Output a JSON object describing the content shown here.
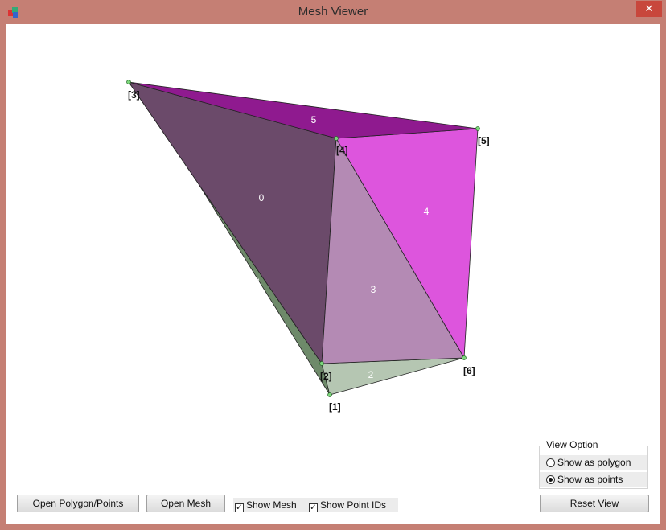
{
  "window": {
    "title": "Mesh Viewer",
    "close_glyph": "✕",
    "icon": "app-icon"
  },
  "viewport": {
    "face_labels": [
      "0",
      "1",
      "2",
      "3",
      "4",
      "5"
    ],
    "point_labels": [
      "[1]",
      "[2]",
      "[3]",
      "[4]",
      "[5]",
      "[6]"
    ],
    "colors": {
      "face0": "#6b4a6a",
      "face1": "#6e8a6a",
      "face2": "#b5c6b2",
      "face3": "#b48ab4",
      "face4": "#dd55dd",
      "face5": "#8f1a8f",
      "point": "#7bd67b"
    }
  },
  "controls": {
    "open_polygon_label": "Open Polygon/Points",
    "open_mesh_label": "Open Mesh",
    "show_mesh_label": "Show Mesh",
    "show_mesh_checked": true,
    "show_ids_label": "Show Point IDs",
    "show_ids_checked": true,
    "view_option_title": "View Option",
    "show_polygon_label": "Show as polygon",
    "show_points_label": "Show as points",
    "selected_view": "Show as points",
    "reset_view_label": "Reset View"
  }
}
